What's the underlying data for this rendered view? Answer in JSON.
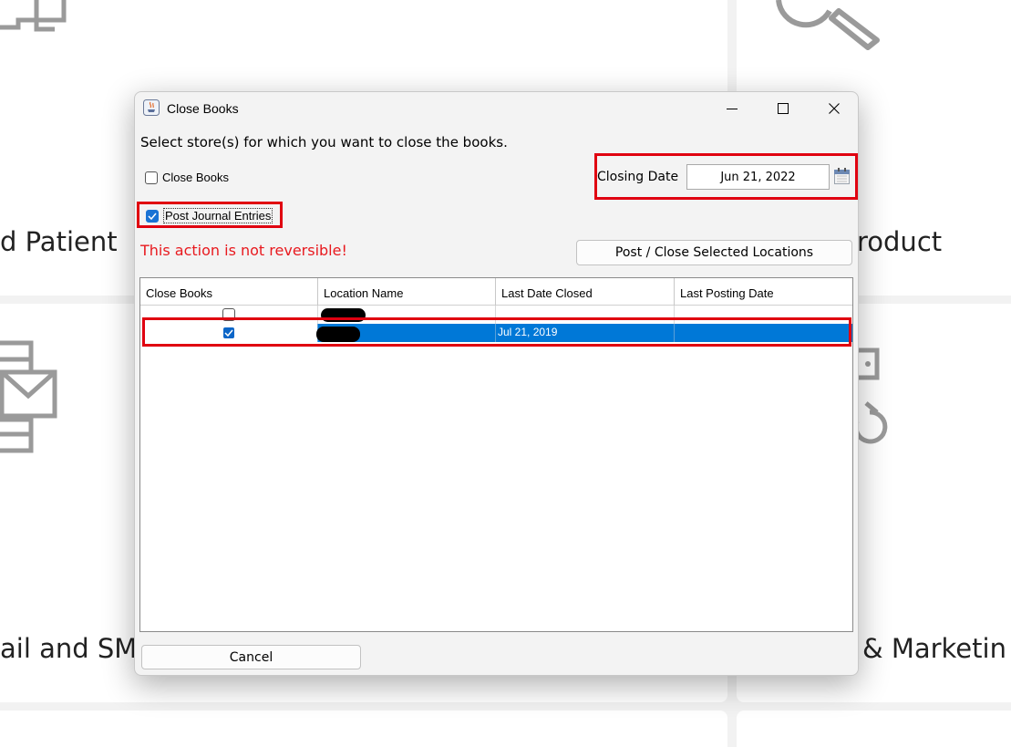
{
  "background": {
    "tiles": [
      {
        "label": "d Patient"
      },
      {
        "label": "roduct"
      },
      {
        "label": "ail and SM"
      },
      {
        "label": "& Marketin"
      }
    ]
  },
  "dialog": {
    "title": "Close Books",
    "app_icon": "java-cup-icon",
    "instruction": "Select store(s) for which you want to close the books.",
    "close_books_checkbox": {
      "label": "Close Books",
      "checked": false
    },
    "post_journal_checkbox": {
      "label": "Post Journal Entries",
      "checked": true
    },
    "closing_date_label": "Closing Date",
    "closing_date_value": "Jun 21, 2022",
    "warning": "This action is not reversible!",
    "post_button_label": "Post / Close Selected Locations",
    "cancel_button_label": "Cancel",
    "table": {
      "columns": [
        "Close Books",
        "Location Name",
        "Last Date Closed",
        "Last Posting Date"
      ],
      "rows": [
        {
          "close_books": false,
          "location_name": "",
          "last_date_closed": "",
          "last_posting_date": "",
          "selected": false
        },
        {
          "close_books": true,
          "location_name": "",
          "last_date_closed": "Jul 21, 2019",
          "last_posting_date": "",
          "selected": true
        }
      ]
    }
  },
  "colors": {
    "highlight_frame": "#e00010",
    "warning_text": "#e8191e",
    "selection": "#0078d7",
    "checkbox_checked": "#1a73d4"
  }
}
